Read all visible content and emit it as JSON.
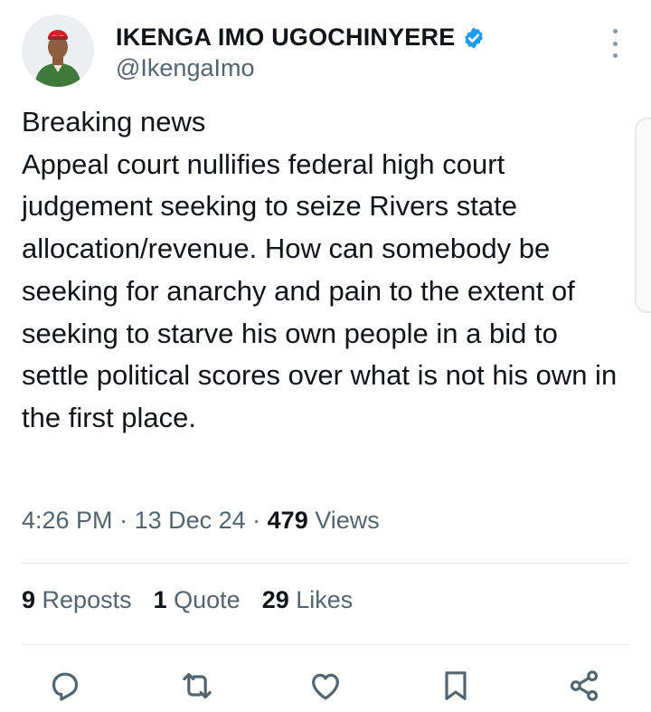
{
  "author": {
    "display_name": "IKENGA IMO UGOCHINYERE",
    "handle": "@IkengaImo",
    "verified_icon": "verified-badge-icon",
    "accent": "#1d9bf0"
  },
  "tweet": {
    "lines": [
      "Breaking news",
      "Appeal court nullifies federal high court judgement seeking to seize Rivers state allocation/revenue. How can somebody be seeking for anarchy and pain to the extent of seeking to starve his own people in a bid to settle political scores over what is not his own in the first place."
    ]
  },
  "meta": {
    "time": "4:26 PM",
    "sep1": " · ",
    "date": "13 Dec 24",
    "sep2": " · ",
    "views_count": "479",
    "views_label": " Views"
  },
  "stats": {
    "reposts_count": "9",
    "reposts_label": " Reposts",
    "quotes_count": "1",
    "quotes_label": " Quote",
    "likes_count": "29",
    "likes_label": " Likes"
  },
  "actions": [
    "reply-icon",
    "repost-icon",
    "like-icon",
    "bookmark-icon",
    "share-icon"
  ],
  "colors": {
    "text": "#0f1419",
    "secondary": "#536471",
    "icon": "#536471",
    "divider": "#e1e6ea"
  }
}
